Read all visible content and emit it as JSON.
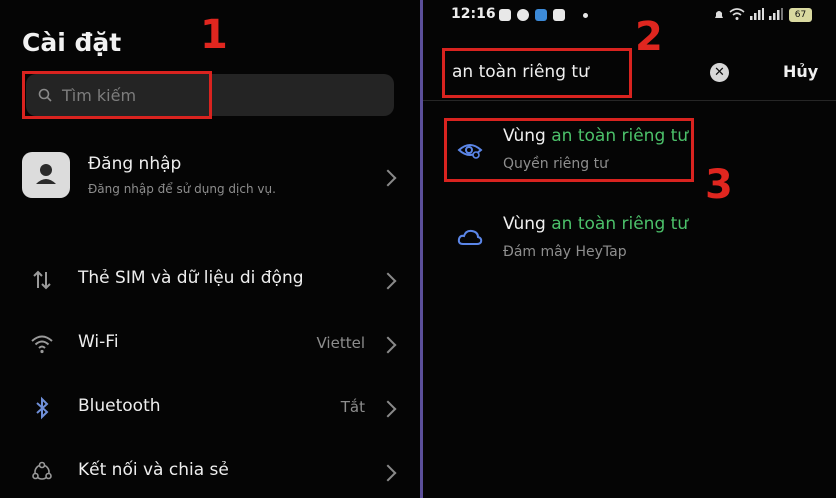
{
  "left": {
    "title": "Cài đặt",
    "search_placeholder": "Tìm kiếm",
    "login": {
      "title": "Đăng nhập",
      "subtitle": "Đăng nhập để sử dụng dịch vụ."
    },
    "items": [
      {
        "label": "Thẻ SIM và dữ liệu di động",
        "value": "",
        "icon": "sim-data-icon"
      },
      {
        "label": "Wi-Fi",
        "value": "Viettel",
        "icon": "wifi-icon"
      },
      {
        "label": "Bluetooth",
        "value": "Tắt",
        "icon": "bluetooth-icon"
      },
      {
        "label": "Kết nối và chia sẻ",
        "value": "",
        "icon": "connection-share-icon"
      }
    ]
  },
  "right": {
    "status": {
      "time": "12:16",
      "battery": "67"
    },
    "search_query": "an toàn riêng tư",
    "clear_symbol": "✕",
    "cancel_label": "Hủy",
    "results": [
      {
        "prefix": "Vùng ",
        "highlight": "an toàn riêng tư",
        "subtitle": "Quyền riêng tư",
        "icon": "privacy-eye-icon"
      },
      {
        "prefix": "Vùng ",
        "highlight": "an toàn riêng tư",
        "subtitle": "Đám mây HeyTap",
        "icon": "cloud-icon"
      }
    ]
  },
  "annotations": {
    "step1": "1",
    "step2": "2",
    "step3": "3"
  },
  "colors": {
    "highlight": "#4cc16a",
    "annotation_red": "#d9231f",
    "divider": "#5b4f9a"
  }
}
